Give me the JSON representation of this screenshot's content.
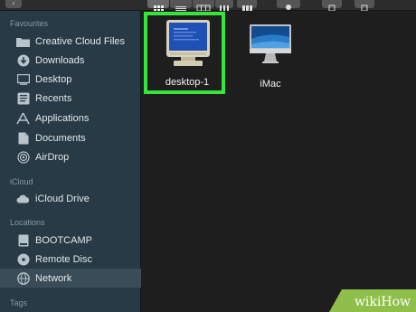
{
  "toolbar": {
    "back_icon": "chevron-left-icon",
    "view_icons": [
      "grid-view-icon",
      "list-view-icon",
      "column-view-icon",
      "gallery-view-icon"
    ],
    "group_icon": "group-icon",
    "action_icon": "gear-icon",
    "share_icon": "share-icon",
    "tag_icon": "tag-icon"
  },
  "sidebar": {
    "favourites": {
      "title": "Favourites",
      "items": [
        {
          "label": "Creative Cloud Files",
          "icon": "folder-icon"
        },
        {
          "label": "Downloads",
          "icon": "downloads-icon"
        },
        {
          "label": "Desktop",
          "icon": "desktop-icon"
        },
        {
          "label": "Recents",
          "icon": "recents-icon"
        },
        {
          "label": "Applications",
          "icon": "applications-icon"
        },
        {
          "label": "Documents",
          "icon": "documents-icon"
        },
        {
          "label": "AirDrop",
          "icon": "airdrop-icon"
        }
      ]
    },
    "icloud": {
      "title": "iCloud",
      "items": [
        {
          "label": "iCloud Drive",
          "icon": "cloud-icon"
        }
      ]
    },
    "locations": {
      "title": "Locations",
      "items": [
        {
          "label": "BOOTCAMP",
          "icon": "disk-icon"
        },
        {
          "label": "Remote Disc",
          "icon": "remote-disc-icon"
        },
        {
          "label": "Network",
          "icon": "network-icon",
          "selected": true
        }
      ]
    },
    "tags": {
      "title": "Tags"
    }
  },
  "content": {
    "files": [
      {
        "name": "desktop-1",
        "icon": "pc-monitor-icon",
        "selected": true
      },
      {
        "name": "iMac",
        "icon": "imac-icon"
      }
    ]
  },
  "watermark": {
    "text": "wikiHow"
  },
  "colors": {
    "highlight": "#39e33d",
    "sidebar": "#273a46",
    "content": "#1e1e1e"
  }
}
